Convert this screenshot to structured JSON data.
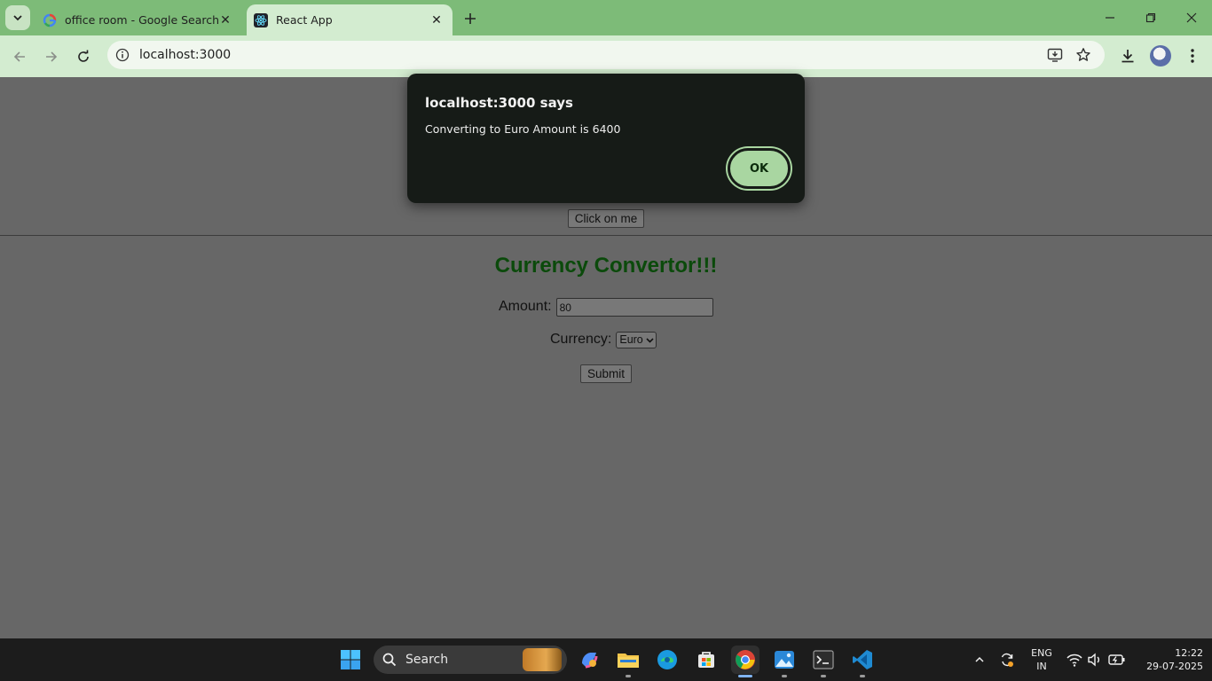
{
  "browser": {
    "tabs": [
      {
        "title": "office room - Google Search",
        "favicon": "google-icon",
        "active": false
      },
      {
        "title": "React App",
        "favicon": "react-icon",
        "active": true
      }
    ],
    "address": "localhost:3000",
    "colors": {
      "frame": "#7dbb78",
      "toolbar": "#d3ecd0"
    }
  },
  "page": {
    "click_button_label": "Click on me",
    "title": "Currency Convertor!!!",
    "amount_label": "Amount:",
    "amount_value": "80",
    "currency_label": "Currency:",
    "currency_selected": "Euro",
    "submit_label": "Submit",
    "colors": {
      "title": "#0b4a0b",
      "overlay_bg": "#676767"
    }
  },
  "dialog": {
    "title": "localhost:3000 says",
    "message": "Converting to Euro Amount is 6400",
    "ok_label": "OK",
    "colors": {
      "bg": "#161b17",
      "button": "#a9d6a1"
    }
  },
  "taskbar": {
    "search_label": "Search",
    "language_line1": "ENG",
    "language_line2": "IN",
    "time": "12:22",
    "date": "29-07-2025",
    "pinned": [
      "windows-start-icon",
      "copilot-icon",
      "file-explorer-icon",
      "edge-icon",
      "store-icon",
      "chrome-icon",
      "photos-icon",
      "terminal-icon",
      "vscode-icon"
    ]
  }
}
